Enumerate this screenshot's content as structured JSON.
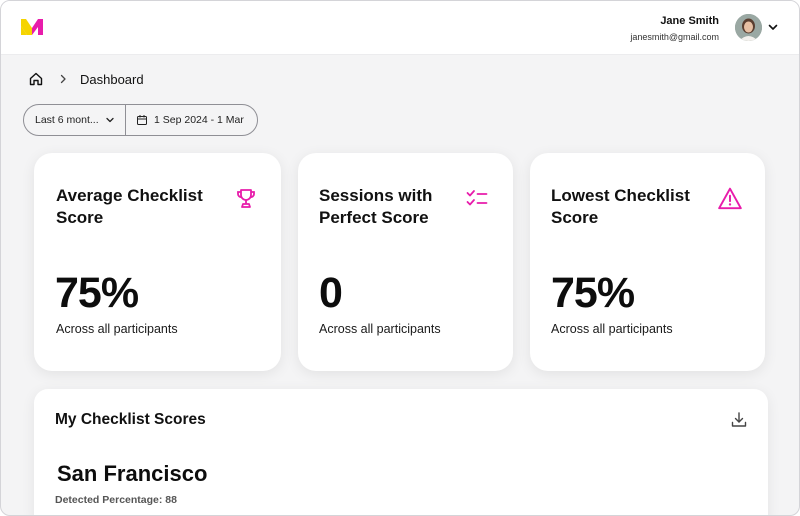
{
  "header": {
    "logo": "M-logo",
    "user_name": "Jane Smith",
    "user_email": "janesmith@gmail.com",
    "avatar": "avatar-photo",
    "menu_icon": "chevron-down-icon"
  },
  "breadcrumb": {
    "home_icon": "home-icon",
    "separator_icon": "chevron-right-icon",
    "current": "Dashboard"
  },
  "filter": {
    "range_label": "Last 6 mont...",
    "range_icon": "chevron-down-icon",
    "date_icon": "calendar-icon",
    "date_label": "1 Sep 2024 - 1 Mar"
  },
  "cards": [
    {
      "title": "Average Checklist Score",
      "value": "75%",
      "subtitle": "Across all participants",
      "icon": "trophy-icon"
    },
    {
      "title": "Sessions with Perfect Score",
      "value": "0",
      "subtitle": "Across all participants",
      "icon": "checklist-icon"
    },
    {
      "title": "Lowest Checklist Score",
      "value": "75%",
      "subtitle": "Across all participants",
      "icon": "warning-icon"
    }
  ],
  "scores": {
    "title": "My Checklist Scores",
    "download_icon": "download-icon",
    "location": "San Francisco",
    "detected": "Detected Percentage: 88"
  },
  "colors": {
    "accent_magenta": "#e81cab",
    "logo_yellow": "#f5d400",
    "logo_magenta": "#e81cab",
    "background": "#f4f4f5"
  }
}
